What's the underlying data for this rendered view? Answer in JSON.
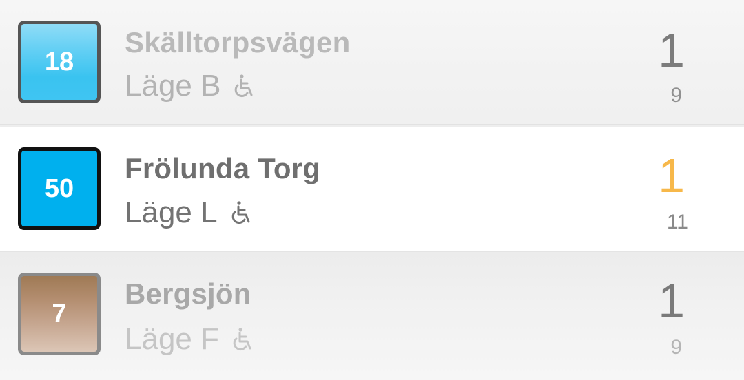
{
  "departures": [
    {
      "line": "18",
      "stop": "Skälltorpsvägen",
      "position": "Läge B",
      "accessible_icon": "wheelchair-icon",
      "minutes": "1",
      "next": "9",
      "badge_color": "#3fc5f2"
    },
    {
      "line": "50",
      "stop": "Frölunda Torg",
      "position": "Läge L",
      "accessible_icon": "wheelchair-icon",
      "minutes": "1",
      "next": "11",
      "badge_color": "#00b0ee",
      "minutes_color": "#f7b84a"
    },
    {
      "line": "7",
      "stop": "Bergsjön",
      "position": "Läge F",
      "accessible_icon": "wheelchair-icon",
      "minutes": "1",
      "next": "9",
      "badge_color": "#b8977c"
    }
  ]
}
